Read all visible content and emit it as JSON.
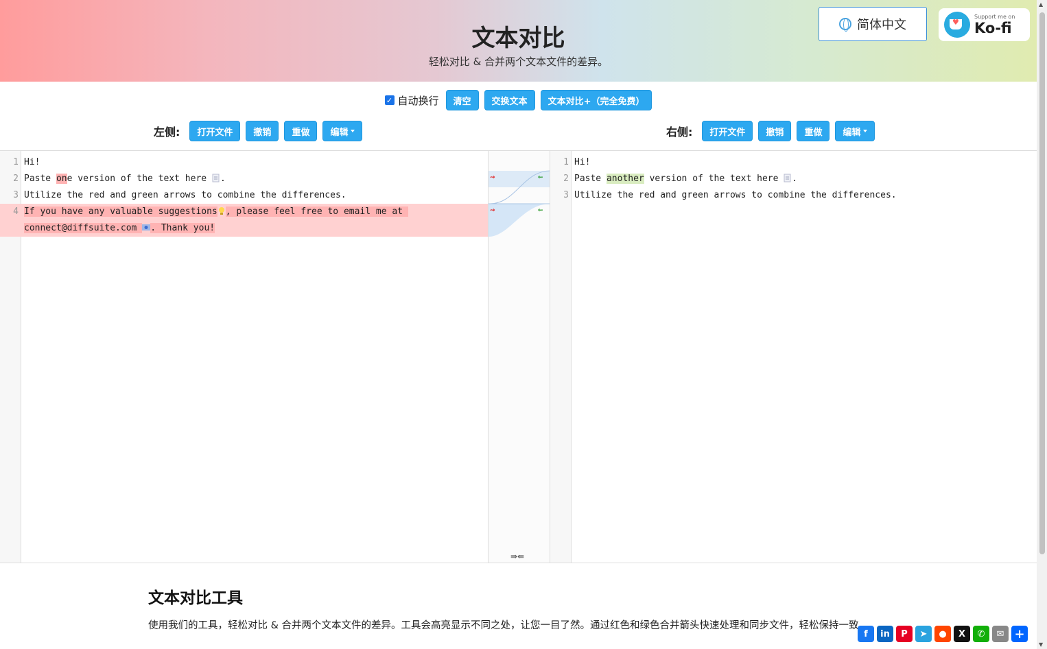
{
  "header": {
    "title": "文本对比",
    "subtitle": "轻松对比 & 合并两个文本文件的差异。",
    "language_button": "简体中文",
    "kofi_small": "Support me on",
    "kofi_big": "Ko-fi"
  },
  "toolbar": {
    "wrap_label": "自动换行",
    "wrap_checked": true,
    "clear": "清空",
    "swap": "交换文本",
    "plus": "文本对比+（完全免费）"
  },
  "left_controls": {
    "label": "左侧:",
    "open": "打开文件",
    "undo": "撤销",
    "redo": "重做",
    "edit": "编辑"
  },
  "right_controls": {
    "label": "右侧:",
    "open": "打开文件",
    "undo": "撤销",
    "redo": "重做",
    "edit": "编辑"
  },
  "left_lines": [
    {
      "n": "1",
      "a": "Hi!"
    },
    {
      "n": "2",
      "a": "Paste ",
      "b": "on",
      "c": "e version of the text here "
    },
    {
      "n": "3",
      "a": "Utilize the red and green arrows to combine the differences."
    },
    {
      "n": "4",
      "a": "If you have any valuable suggestions",
      "c": ", please feel free to email me at ",
      "d": "connect@diffsuite.com ",
      "e": ". Thank you!"
    }
  ],
  "right_lines": [
    {
      "n": "1",
      "a": "Hi!"
    },
    {
      "n": "2",
      "a": "Paste ",
      "b": "another",
      "c": " version of the text here "
    },
    {
      "n": "3",
      "a": "Utilize the red and green arrows to combine the differences."
    }
  ],
  "merge_all_glyph": "⇛⇚",
  "section": {
    "title": "文本对比工具",
    "text": "使用我们的工具，轻松对比 & 合并两个文本文件的差异。工具会高亮显示不同之处，让您一目了然。通过红色和绿色合并箭头快速处理和同步文件，轻松保持一致。"
  },
  "share_icons": [
    "facebook-icon",
    "linkedin-icon",
    "pinterest-icon",
    "telegram-icon",
    "reddit-icon",
    "x-icon",
    "whatsapp-icon",
    "email-icon",
    "share-plus-icon"
  ],
  "colors": {
    "button_blue": "#2da8f0",
    "deleted_line": "#ffd1d1",
    "added_line": "#eef3e6"
  }
}
